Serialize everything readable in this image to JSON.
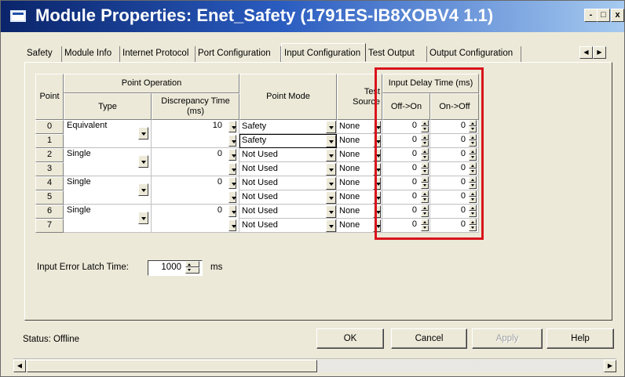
{
  "window": {
    "title": "Module Properties: Enet_Safety (1791ES-IB8XOBV4 1.1)",
    "min_glyph": "-",
    "max_glyph": "□",
    "close_glyph": "x",
    "border_color": "#6a6a6a"
  },
  "tabs": [
    {
      "label": "Safety",
      "active": false
    },
    {
      "label": "Module Info",
      "active": false
    },
    {
      "label": "Internet Protocol",
      "active": false
    },
    {
      "label": "Port Configuration",
      "active": false
    },
    {
      "label": "Input Configuration",
      "active": true
    },
    {
      "label": "Test Output",
      "active": false
    },
    {
      "label": "Output Configuration",
      "active": false
    }
  ],
  "tab_scroll": {
    "left": "◀",
    "right": "▶"
  },
  "grid": {
    "headers": {
      "point": "Point",
      "point_operation": "Point Operation",
      "type": "Type",
      "discrepancy": "Discrepancy Time (ms)",
      "point_mode": "Point Mode",
      "test_source": "Test Source",
      "input_delay": "Input Delay Time (ms)",
      "off_on": "Off->On",
      "on_off": "On->Off"
    },
    "pairs": [
      {
        "type": "Equivalent",
        "discrepancy": "10"
      },
      {
        "type": "Single",
        "discrepancy": "0"
      },
      {
        "type": "Single",
        "discrepancy": "0"
      },
      {
        "type": "Single",
        "discrepancy": "0"
      }
    ],
    "rows": [
      {
        "point": "0",
        "mode": "Safety",
        "source": "None",
        "off_on": "0",
        "on_off": "0"
      },
      {
        "point": "1",
        "mode": "Safety",
        "source": "None",
        "off_on": "0",
        "on_off": "0"
      },
      {
        "point": "2",
        "mode": "Not Used",
        "source": "None",
        "off_on": "0",
        "on_off": "0"
      },
      {
        "point": "3",
        "mode": "Not Used",
        "source": "None",
        "off_on": "0",
        "on_off": "0"
      },
      {
        "point": "4",
        "mode": "Not Used",
        "source": "None",
        "off_on": "0",
        "on_off": "0"
      },
      {
        "point": "5",
        "mode": "Not Used",
        "source": "None",
        "off_on": "0",
        "on_off": "0"
      },
      {
        "point": "6",
        "mode": "Not Used",
        "source": "None",
        "off_on": "0",
        "on_off": "0"
      },
      {
        "point": "7",
        "mode": "Not Used",
        "source": "None",
        "off_on": "0",
        "on_off": "0"
      }
    ],
    "highlight_color": "#d8141c"
  },
  "latch": {
    "label": "Input Error Latch Time:",
    "value": "1000",
    "unit": "ms"
  },
  "status": {
    "label": "Status:  Offline"
  },
  "buttons": {
    "ok": "OK",
    "cancel": "Cancel",
    "apply": "Apply",
    "help": "Help"
  },
  "scrollbar": {
    "left": "◀",
    "right": "▶"
  }
}
